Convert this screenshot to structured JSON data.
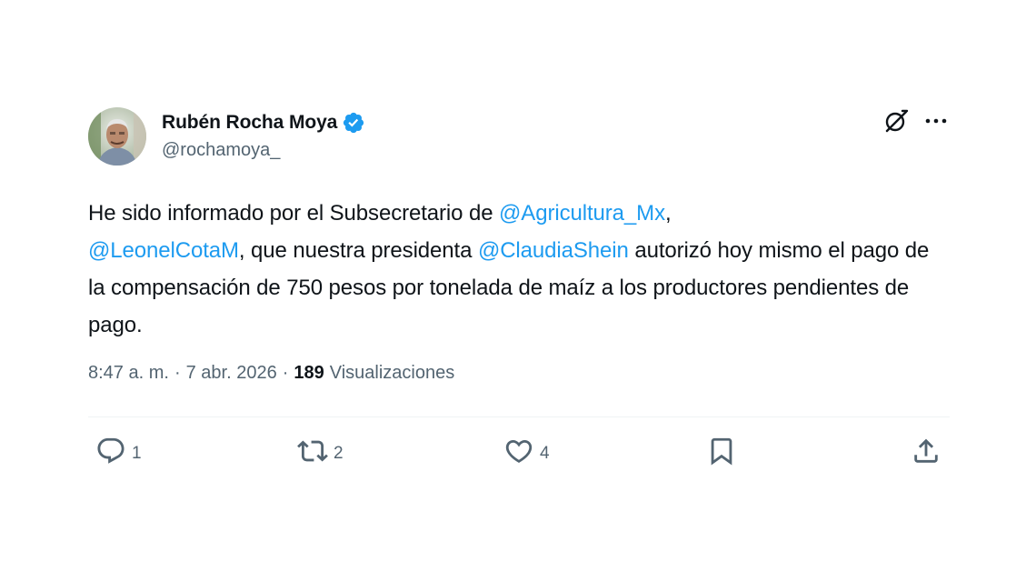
{
  "tweet": {
    "author": {
      "display_name": "Rubén Rocha Moya",
      "handle": "@rochamoya_",
      "verified": true
    },
    "text_segments": [
      {
        "text": "He sido informado por el Subsecretario de ",
        "mention": false
      },
      {
        "text": "@Agricultura_Mx",
        "mention": true
      },
      {
        "text": ", ",
        "mention": false
      },
      {
        "text": "@LeonelCotaM",
        "mention": true
      },
      {
        "text": ", que nuestra presidenta ",
        "mention": false
      },
      {
        "text": "@ClaudiaShein",
        "mention": true
      },
      {
        "text": " autorizó  hoy mismo el pago de la compensación de 750 pesos por tonelada de maíz a los productores pendientes de pago.",
        "mention": false
      }
    ],
    "time": "8:47 a. m.",
    "date": "7 abr. 2026",
    "views_count": "189",
    "views_label": "Visualizaciones",
    "actions": {
      "replies": "1",
      "reposts": "2",
      "likes": "4"
    }
  },
  "colors": {
    "accent": "#1d9bf0",
    "text": "#0f1419",
    "secondary": "#536471",
    "divider": "#eff3f4"
  },
  "icons": [
    "verified-badge-icon",
    "grok-icon",
    "more-icon",
    "reply-icon",
    "repost-icon",
    "like-icon",
    "bookmark-icon",
    "share-icon"
  ]
}
